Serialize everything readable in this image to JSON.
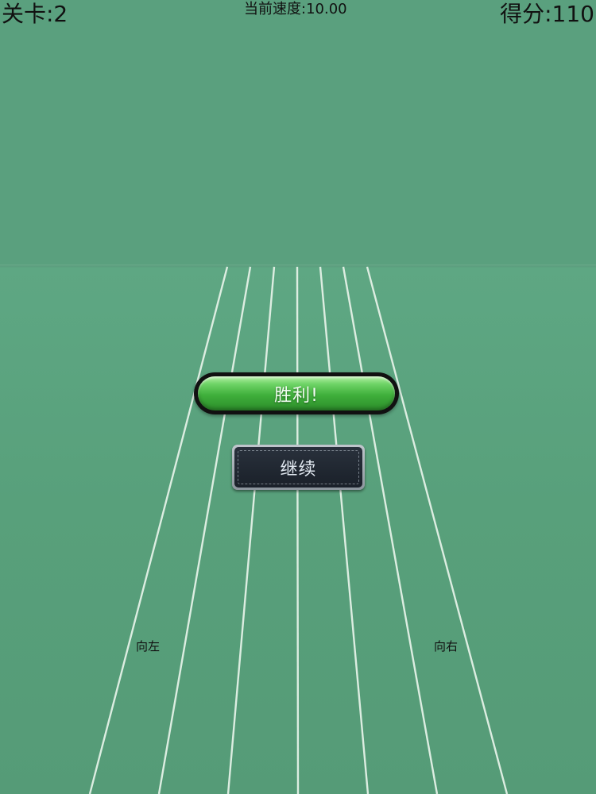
{
  "hud": {
    "level_label": "关卡:2",
    "speed_label": "当前速度:10.00",
    "score_label": "得分:110"
  },
  "game": {
    "level": 2,
    "speed": 10.0,
    "score": 110,
    "lane_line_count": 7
  },
  "result_dialog": {
    "banner_text": "胜利!",
    "continue_label": "继续"
  },
  "controls": {
    "left_label": "向左",
    "right_label": "向右"
  },
  "colors": {
    "sky": "#5aa07e",
    "ground": "#58a07b",
    "lane_line": "#e8f4ea",
    "banner_green": "#3faf3b",
    "continue_bg": "#1a2029"
  }
}
